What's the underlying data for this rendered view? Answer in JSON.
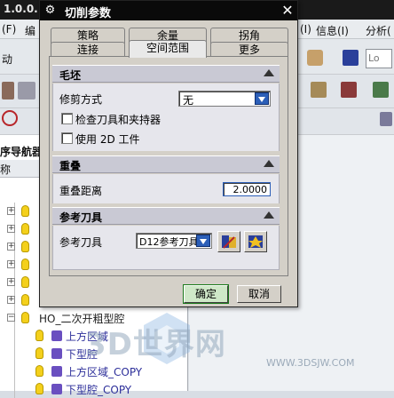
{
  "app": {
    "title_fragment": "1.0.0.",
    "menu": [
      "(F)",
      "编",
      "(I)",
      "信息(I)",
      "分析("
    ],
    "left_fragments": [
      "动",
      "序导航器",
      "称"
    ],
    "search_fragment": "Lo"
  },
  "navigator": {
    "items": [
      {
        "label": "上方区域"
      },
      {
        "label": "下型腔"
      },
      {
        "label": "上方区域_COPY"
      },
      {
        "label": "下型腔_COPY"
      }
    ],
    "partial_row": "HO_二次开粗型腔"
  },
  "dialog": {
    "title": "切削参数",
    "tabs_row1": [
      "策略",
      "余量",
      "拐角"
    ],
    "tabs_row2": [
      "连接",
      "空间范围",
      "更多"
    ],
    "active_tab": "空间范围",
    "groups": {
      "blank": {
        "title": "毛坯",
        "trim_label": "修剪方式",
        "trim_value": "无",
        "check_tool_label": "检查刀具和夹持器",
        "use_2d_label": "使用 2D 工件"
      },
      "overlap": {
        "title": "重叠",
        "distance_label": "重叠距离",
        "distance_value": "2.0000"
      },
      "reference_tool": {
        "title": "参考刀具",
        "tool_label": "参考刀具",
        "tool_value": "D12参考刀具"
      }
    },
    "buttons": {
      "ok": "确定",
      "cancel": "取消"
    }
  },
  "watermark": {
    "text": "3D世界网",
    "url": "WWW.3DSJW.COM"
  },
  "colors": {
    "dialog_bg": "#d4d0c8",
    "title_bar": "#0a0a0a",
    "group_header": "#c9c9d4",
    "dropdown_accent": "#2c5fb8"
  }
}
